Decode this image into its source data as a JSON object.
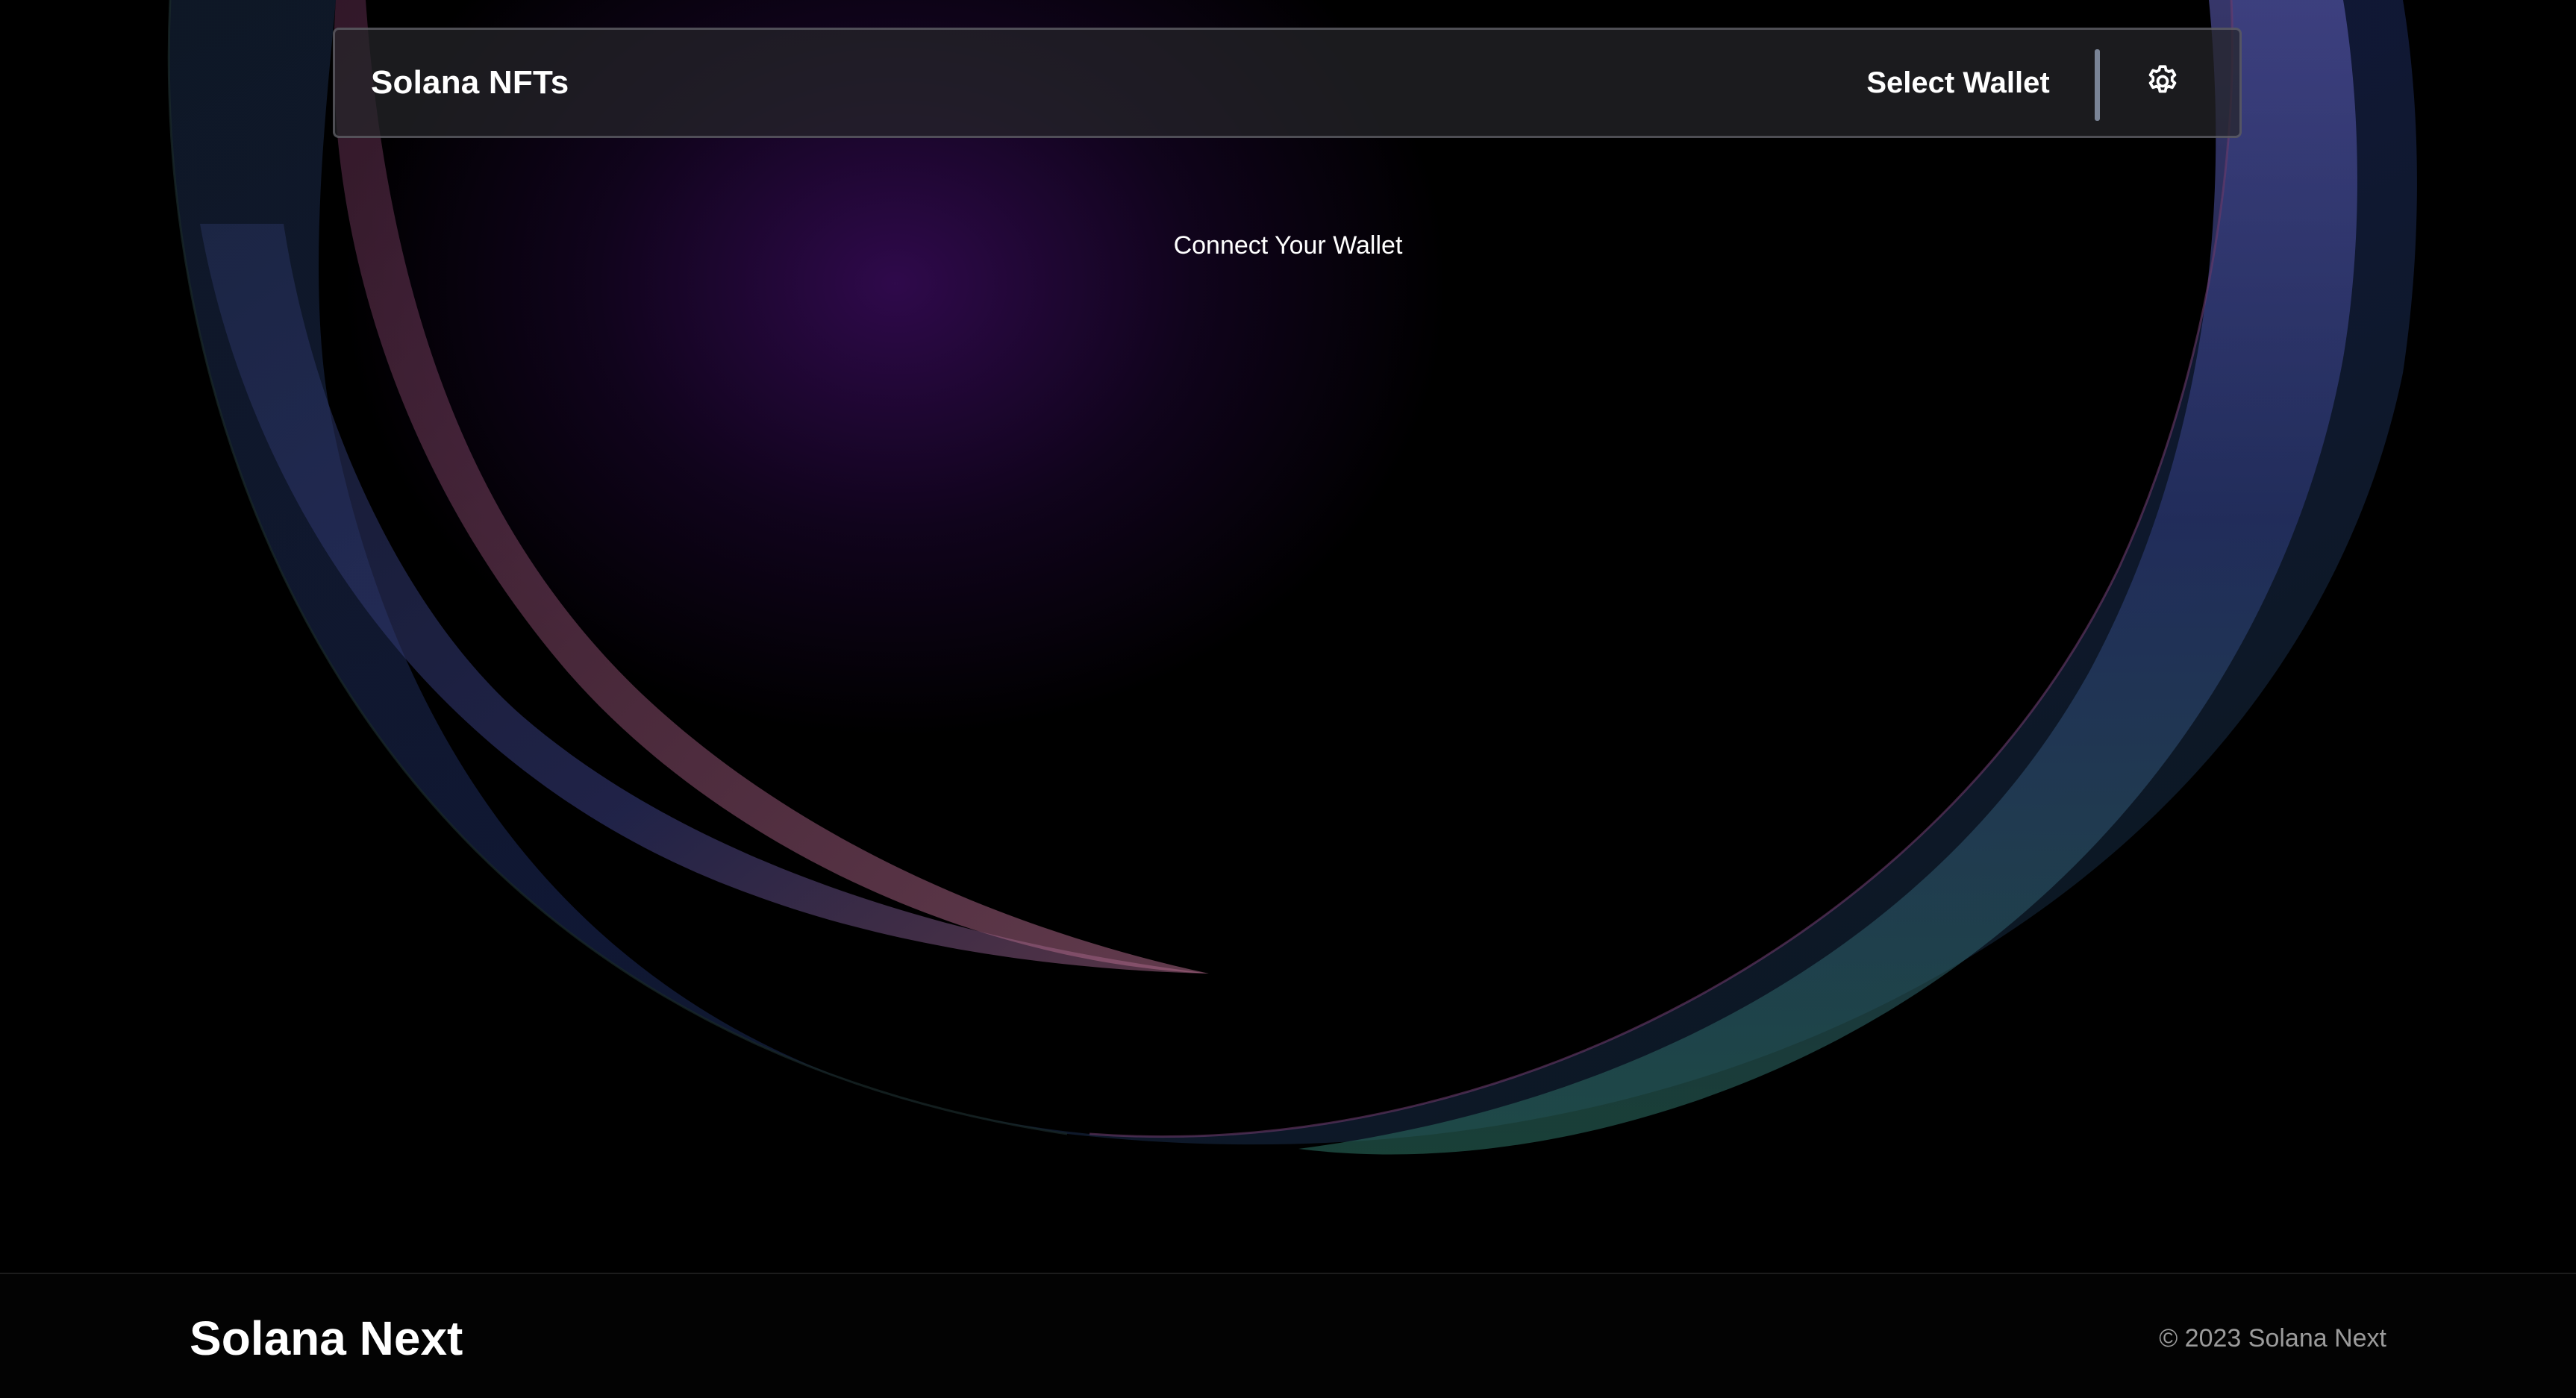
{
  "navbar": {
    "brand": "Solana NFTs",
    "select_wallet_label": "Select Wallet",
    "settings_icon": "gear-icon"
  },
  "main": {
    "connect_message": "Connect Your Wallet"
  },
  "footer": {
    "brand": "Solana Next",
    "copyright": "© 2023 Solana Next"
  },
  "colors": {
    "background": "#000000",
    "navbar_bg": "#26262a",
    "navbar_border": "#787882",
    "divider": "#7a8496",
    "footer_text_muted": "#9b9b9b",
    "glow_purple": "#3c0c60",
    "ring_pink": "#b06a8a",
    "ring_blue": "#3c4f9a",
    "ring_teal": "#2f7a6a"
  }
}
